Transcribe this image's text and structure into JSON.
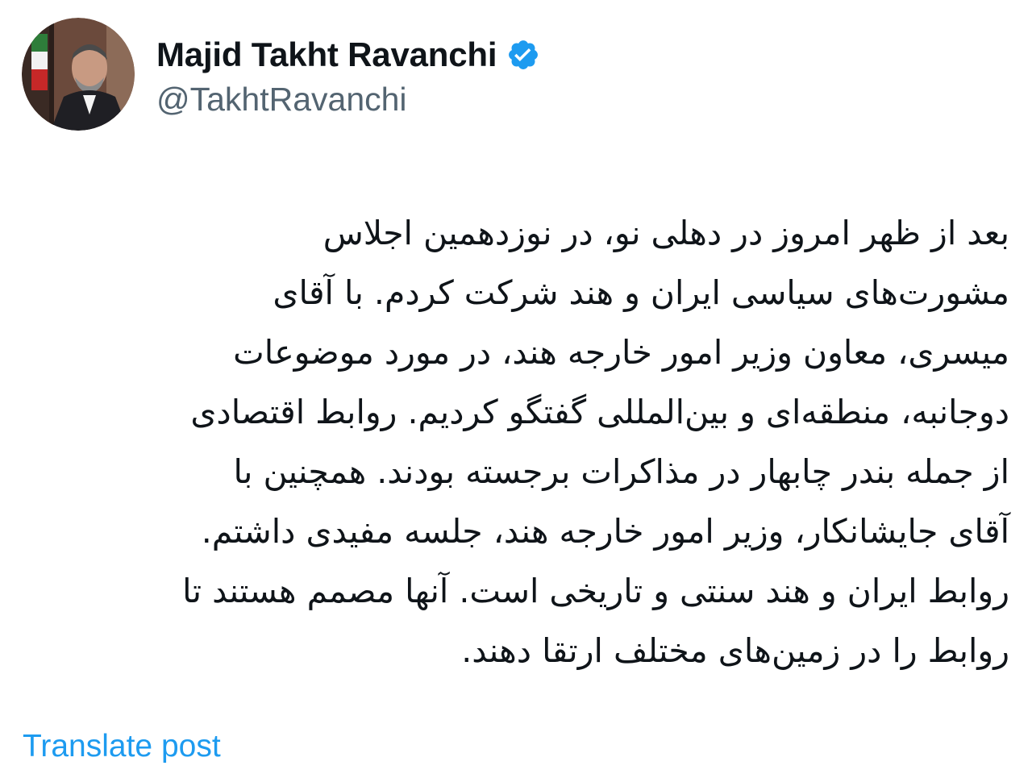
{
  "colors": {
    "text": "#0f1419",
    "secondary": "#536471",
    "accent": "#1d9bf0",
    "verified_badge": "#1d9bf0"
  },
  "author": {
    "display_name": "Majid Takht Ravanchi",
    "handle": "@TakhtRavanchi",
    "verified_icon": "verified-badge-icon",
    "avatar": "profile-photo"
  },
  "post": {
    "lines": [
      "بعد از ظهر امروز در دهلی نو، در نوزدهمین اجلاس",
      "مشورت‌های سیاسی ایران و هند شرکت کردم. با آقای",
      "میسری، معاون وزیر امور خارجه هند، در مورد موضوعات",
      "دوجانبه، منطقه‌ای و بین‌المللی گفتگو کردیم. روابط اقتصادی",
      "از جمله بندر چابهار در مذاکرات برجسته بودند. همچنین با",
      "آقای جایشانکار، وزیر امور خارجه هند، جلسه مفیدی داشتم.",
      "روابط ایران و هند سنتی و تاریخی است. آنها مصمم هستند تا",
      "روابط را در زمین‌های مختلف ارتقا دهند."
    ]
  },
  "actions": {
    "translate_label": "Translate post"
  }
}
